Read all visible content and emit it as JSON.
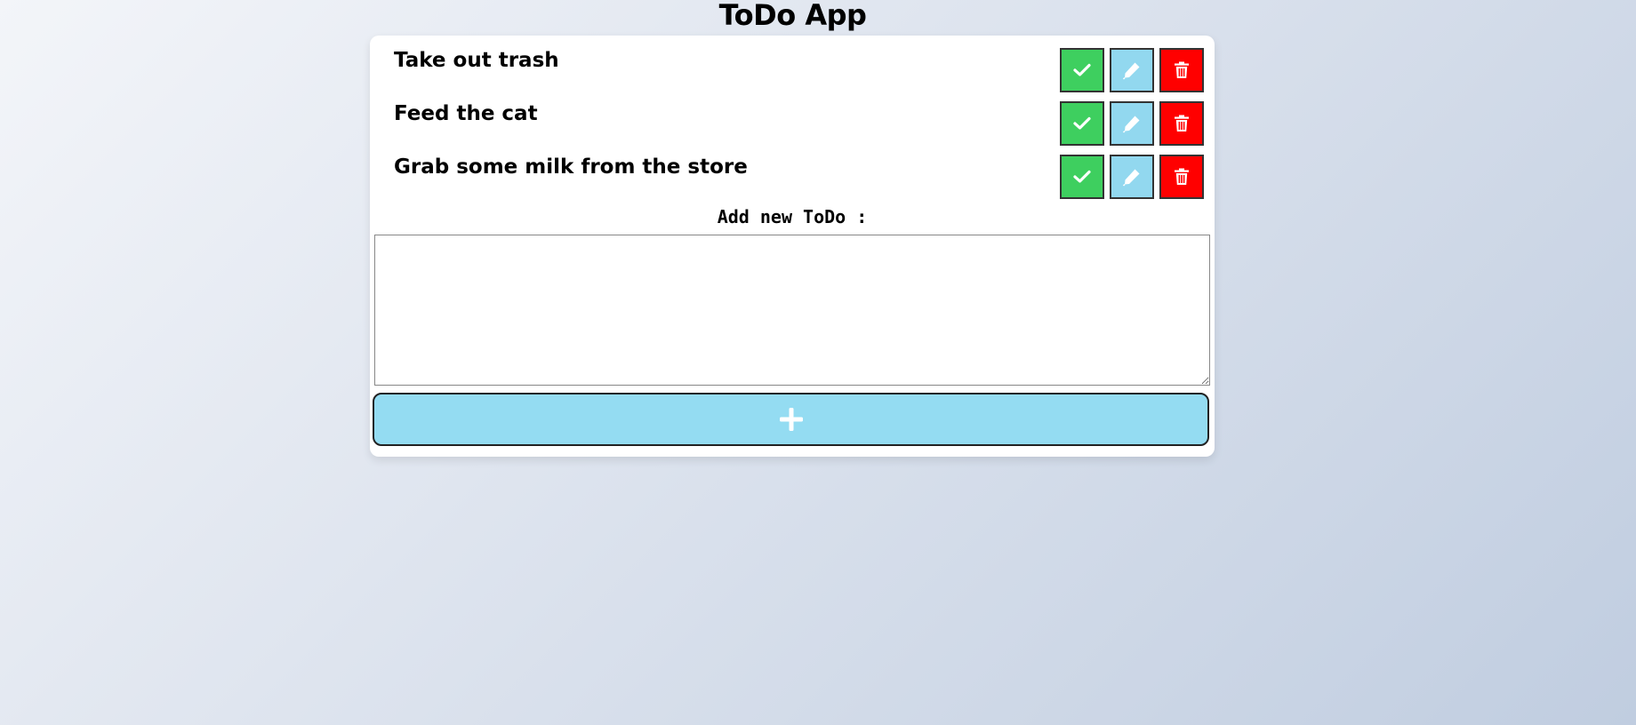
{
  "app": {
    "title": "ToDo App"
  },
  "todos": [
    {
      "text": "Take out trash"
    },
    {
      "text": "Feed the cat"
    },
    {
      "text": "Grab some milk from the store"
    }
  ],
  "item_actions": {
    "done_icon": "check-icon",
    "edit_icon": "pencil-icon",
    "delete_icon": "trash-icon"
  },
  "add_form": {
    "label": "Add new ToDo :",
    "input_value": "",
    "add_icon": "plus-icon"
  },
  "colors": {
    "done": "#3ecf5f",
    "edit": "#92d8ef",
    "delete": "#ff0000",
    "add_button": "#94dcf2"
  }
}
